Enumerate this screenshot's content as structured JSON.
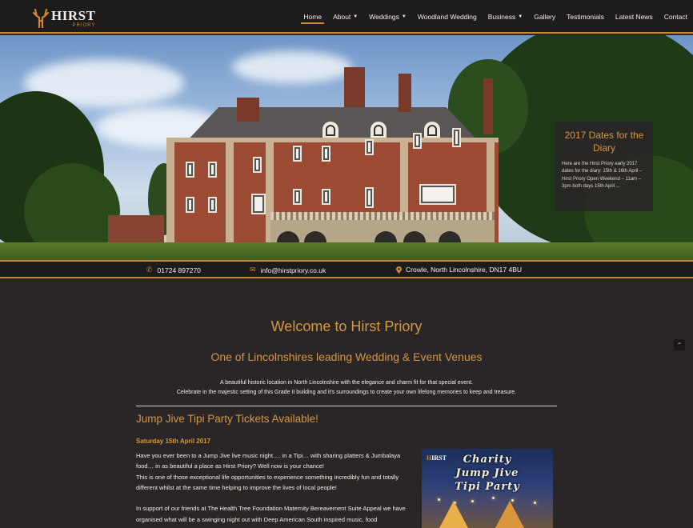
{
  "brand": {
    "name": "HIRST",
    "sub": "PRIORY"
  },
  "nav": [
    {
      "label": "Home",
      "active": true,
      "dropdown": false
    },
    {
      "label": "About",
      "dropdown": true
    },
    {
      "label": "Weddings",
      "dropdown": true
    },
    {
      "label": "Woodland Wedding",
      "dropdown": false
    },
    {
      "label": "Business",
      "dropdown": true
    },
    {
      "label": "Gallery",
      "dropdown": false
    },
    {
      "label": "Testimonials",
      "dropdown": false
    },
    {
      "label": "Latest News",
      "dropdown": false
    },
    {
      "label": "Contact",
      "dropdown": false
    }
  ],
  "diary": {
    "title": "2017 Dates for the Diary",
    "text": "Here are the Hirst Priory early 2017 dates for the diary: 15th & 16th April – Hirst Priory Open Weekend – 11am – 3pm both days 15th April ..."
  },
  "contact": {
    "phone": "01724 897270",
    "email": "info@hirstpriory.co.uk",
    "location": "Crowle, North Lincolnshire, DN17 4BU"
  },
  "main": {
    "welcome": "Welcome to Hirst Priory",
    "subtitle": "One of Lincolnshires leading Wedding & Event Venues",
    "intro_line1": "A beautiful historic location in North Lincolnshire with the elegance and charm fit for that special event.",
    "intro_line2": "Celebrate in the majestic setting of this Grade II building and it's surroundings to create your own lifelong memories to keep and treasure."
  },
  "article": {
    "title": "Jump Jive Tipi Party Tickets Available!",
    "date": "Saturday 15th April 2017",
    "para1": "Have you ever been to a Jump Jive live music night…. in a Tipi… with sharing platters & Jumbalaya food… in as beautiful a place as Hirst Priory?  Well now is your chance!",
    "para2": "This is one of those exceptional life opportunities to experience something incredibly fun and totally different whilst at the same time helping to improve the lives of local people!",
    "para3": "In support of our friends at The Health Tree Foundation Maternity Bereavement Suite Appeal we have organised what will be a swinging night out with Deep American South inspired music, food"
  },
  "poster": {
    "logo_h": "H",
    "logo_rest": "IRST",
    "line1": "Charity",
    "line2": "Jump Jive",
    "line3": "Tipi Party"
  },
  "icons": {
    "phone": "phone-icon",
    "email": "envelope-icon",
    "location": "map-marker-icon",
    "scroll": "chevron-up-icon"
  },
  "colors": {
    "accent": "#c88a35",
    "heading": "#d4963f",
    "background": "#2a2627",
    "bar": "#1e1b1c"
  }
}
